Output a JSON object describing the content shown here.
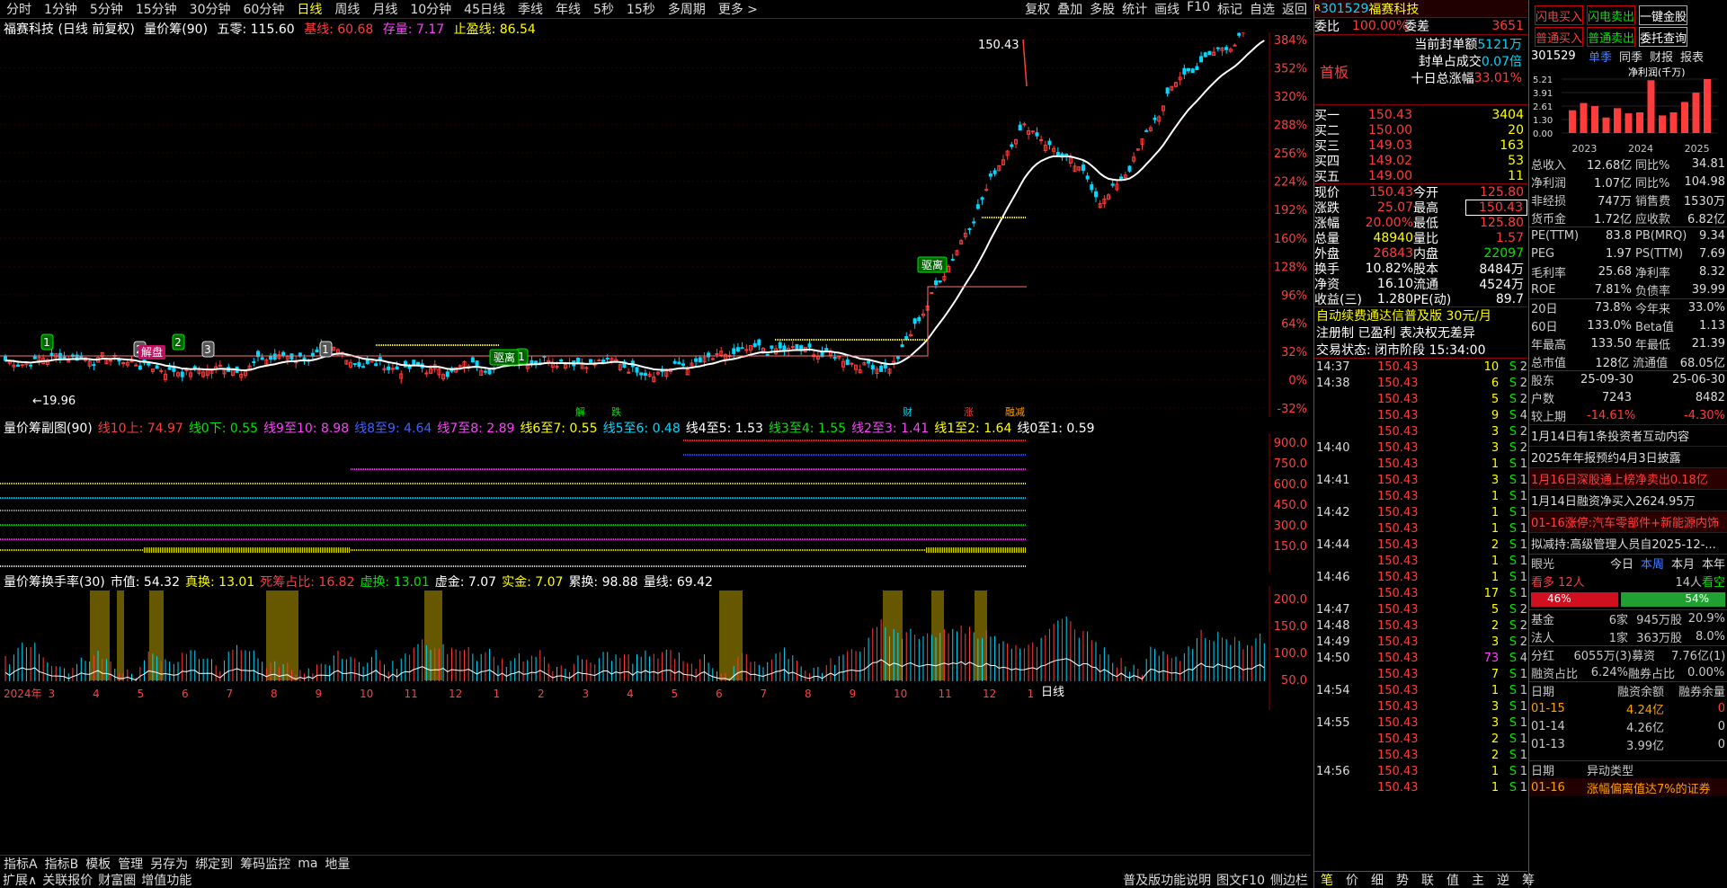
{
  "toolbar": {
    "periods": [
      "分时",
      "1分钟",
      "5分钟",
      "15分钟",
      "30分钟",
      "60分钟",
      "日线",
      "周线",
      "月线",
      "10分钟",
      "45日线",
      "季线",
      "年线",
      "5秒",
      "15秒",
      "多周期",
      "更多 >"
    ],
    "active": "日线",
    "right": [
      "复权",
      "叠加",
      "多股",
      "统计",
      "画线",
      "F10",
      "标记",
      "自选",
      "返回"
    ]
  },
  "info": {
    "name": "福赛科技 (日线 前复权)",
    "ind": "量价筹(90)",
    "wuling": "五零: 115.60",
    "jixian": "基线: 60.68",
    "cunliang": "存量: 7.17",
    "zhiying": "止盈线: 86.54"
  },
  "main_axis": [
    "384%",
    "352%",
    "320%",
    "288%",
    "256%",
    "224%",
    "192%",
    "160%",
    "128%",
    "96%",
    "64%",
    "32%",
    "0%",
    "-32%"
  ],
  "labels": {
    "high": "150.43",
    "low": "19.96",
    "badges": [
      "1",
      "2",
      "2",
      "3",
      "1",
      "1"
    ],
    "qumai": "驱离",
    "qumai2": "驱离",
    "jiepan": "解盘",
    "days": [
      "解",
      "跌",
      "涨",
      "融减",
      "财"
    ]
  },
  "sub": {
    "title": "量价筹副图(90)",
    "items": [
      {
        "k": "线10上:",
        "v": "74.97",
        "c": "r"
      },
      {
        "k": "线0下:",
        "v": "0.55",
        "c": "g"
      },
      {
        "k": "线9至10:",
        "v": "8.98",
        "c": "m"
      },
      {
        "k": "线8至9:",
        "v": "4.64",
        "c": "b"
      },
      {
        "k": "线7至8:",
        "v": "2.89",
        "c": "m"
      },
      {
        "k": "线6至7:",
        "v": "0.55",
        "c": "y"
      },
      {
        "k": "线5至6:",
        "v": "0.48",
        "c": "c"
      },
      {
        "k": "线4至5:",
        "v": "1.53",
        "c": "w"
      },
      {
        "k": "线3至4:",
        "v": "1.55",
        "c": "g"
      },
      {
        "k": "线2至3:",
        "v": "1.41",
        "c": "m"
      },
      {
        "k": "线1至2:",
        "v": "1.64",
        "c": "y"
      },
      {
        "k": "线0至1:",
        "v": "0.59",
        "c": "w"
      }
    ],
    "axis": [
      "900.0",
      "750.0",
      "600.0",
      "450.0",
      "300.0",
      "150.0"
    ]
  },
  "tv": {
    "title": "量价筹换手率(30)",
    "items": [
      {
        "k": "市值:",
        "v": "54.32",
        "c": "w"
      },
      {
        "k": "真换:",
        "v": "13.01",
        "c": "y"
      },
      {
        "k": "死筹占比:",
        "v": "16.82",
        "c": "r"
      },
      {
        "k": "虚换:",
        "v": "13.01",
        "c": "g"
      },
      {
        "k": "虚金:",
        "v": "7.07",
        "c": "w"
      },
      {
        "k": "实金:",
        "v": "7.07",
        "c": "y"
      },
      {
        "k": "累换:",
        "v": "98.88",
        "c": "w"
      },
      {
        "k": "量线:",
        "v": "69.42",
        "c": "w"
      }
    ],
    "axis": [
      "200.0",
      "150.0",
      "100.0",
      "50.0"
    ],
    "months": [
      "2024年",
      "3",
      "4",
      "5",
      "6",
      "7",
      "8",
      "9",
      "10",
      "11",
      "12",
      "1",
      "2",
      "3",
      "4",
      "5",
      "6",
      "7",
      "8",
      "9",
      "10",
      "11",
      "12",
      "1"
    ],
    "daycycle": "日线"
  },
  "bottom1": [
    "指标A",
    "指标B",
    "模板",
    "管理",
    "另存为",
    "绑定到",
    "筹码监控",
    "ma",
    "地量"
  ],
  "bottom2": [
    "扩展∧",
    "关联报价",
    "财富圈",
    "增值功能"
  ],
  "bottom_right": [
    "普及版功能说明",
    "图文F10",
    "侧边栏"
  ],
  "fbottom": [
    "笔",
    "价",
    "细",
    "势",
    "联",
    "值",
    "主",
    "逆",
    "筹"
  ],
  "quote": {
    "code": "301529",
    "name": "福赛科技",
    "weibi": "委比",
    "weibi_v": "100.00%",
    "weicha": "委差",
    "weicha_v": "3651",
    "board": "首板",
    "lines": [
      {
        "k": "当前封单额",
        "v": "5121万"
      },
      {
        "k": "封单占成交",
        "v": "0.07倍"
      },
      {
        "k": "十日总涨幅",
        "v": "33.01%"
      }
    ],
    "buys": [
      {
        "k": "买一",
        "p": "150.43",
        "v": "3404"
      },
      {
        "k": "买二",
        "p": "150.00",
        "v": "20"
      },
      {
        "k": "买三",
        "p": "149.03",
        "v": "163"
      },
      {
        "k": "买四",
        "p": "149.02",
        "v": "53"
      },
      {
        "k": "买五",
        "p": "149.00",
        "v": "11"
      }
    ],
    "stats": [
      [
        "现价",
        "150.43",
        "今开",
        "125.80"
      ],
      [
        "涨跌",
        "25.07",
        "最高",
        "150.43"
      ],
      [
        "涨幅",
        "20.00%",
        "最低",
        "125.80"
      ],
      [
        "总量",
        "48940",
        "量比",
        "1.57"
      ],
      [
        "外盘",
        "26843",
        "内盘",
        "22097"
      ],
      [
        "换手",
        "10.82%",
        "股本",
        "8484万"
      ],
      [
        "净资",
        "16.10",
        "流通",
        "4524万"
      ],
      [
        "收益(三)",
        "1.280",
        "PE(动)",
        "89.7"
      ]
    ],
    "promo": "自动续费通达信普及版 30元/月",
    "reg": "注册制 已盈利 表决权无差异",
    "status": "交易状态: 闭市阶段 15:34:00",
    "ticks": [
      [
        "14:37",
        "150.43",
        "10",
        "S",
        "2"
      ],
      [
        "14:38",
        "150.43",
        "6",
        "S",
        "2"
      ],
      [
        "",
        "150.43",
        "5",
        "S",
        "2"
      ],
      [
        "",
        "150.43",
        "9",
        "S",
        "4"
      ],
      [
        "",
        "150.43",
        "3",
        "S",
        "2"
      ],
      [
        "14:40",
        "150.43",
        "3",
        "S",
        "2"
      ],
      [
        "",
        "150.43",
        "1",
        "S",
        "1"
      ],
      [
        "14:41",
        "150.43",
        "3",
        "S",
        "1"
      ],
      [
        "",
        "150.43",
        "1",
        "S",
        "1"
      ],
      [
        "14:42",
        "150.43",
        "1",
        "S",
        "1"
      ],
      [
        "",
        "150.43",
        "1",
        "S",
        "1"
      ],
      [
        "14:44",
        "150.43",
        "2",
        "S",
        "1"
      ],
      [
        "",
        "150.43",
        "1",
        "S",
        "1"
      ],
      [
        "14:46",
        "150.43",
        "1",
        "S",
        "1"
      ],
      [
        "",
        "150.43",
        "17",
        "S",
        "1"
      ],
      [
        "14:47",
        "150.43",
        "5",
        "S",
        "2"
      ],
      [
        "14:48",
        "150.43",
        "2",
        "S",
        "2"
      ],
      [
        "14:49",
        "150.43",
        "3",
        "S",
        "2"
      ],
      [
        "14:50",
        "150.43",
        "73",
        "S",
        "4"
      ],
      [
        "",
        "150.43",
        "7",
        "S",
        "1"
      ],
      [
        "14:54",
        "150.43",
        "1",
        "S",
        "1"
      ],
      [
        "",
        "150.43",
        "3",
        "S",
        "1"
      ],
      [
        "14:55",
        "150.43",
        "3",
        "S",
        "1"
      ],
      [
        "",
        "150.43",
        "2",
        "S",
        "1"
      ],
      [
        "",
        "150.43",
        "2",
        "S",
        "1"
      ],
      [
        "14:56",
        "150.43",
        "1",
        "S",
        "1"
      ],
      [
        "",
        "150.43",
        "1",
        "S",
        "1"
      ]
    ]
  },
  "fin": {
    "btns": [
      "闪电买入",
      "闪电卖出",
      "一键金股",
      "普通买入",
      "普通卖出",
      "委托查询"
    ],
    "code": "301529",
    "tabs": [
      "单季",
      "同季",
      "财报",
      "报表"
    ],
    "chart_title": "净利润(千万)",
    "yaxis": [
      "5.21",
      "3.91",
      "2.61",
      "1.30",
      "0.00"
    ],
    "xaxis": [
      "2023",
      "2024",
      "2025"
    ],
    "bars": [
      2.2,
      2.9,
      2.6,
      1.5,
      2.4,
      1.9,
      2.0,
      5.1,
      1.7,
      2.0,
      3.0,
      3.9,
      5.21
    ],
    "rows": [
      [
        "总收入",
        "12.68亿",
        "同比%",
        "34.81"
      ],
      [
        "净利润",
        "1.07亿",
        "同比%",
        "104.98"
      ],
      [
        "非经损",
        "747万",
        "销售费",
        "1530万"
      ],
      [
        "货币金",
        "1.72亿",
        "应收款",
        "6.82亿"
      ],
      [
        "PE(TTM)",
        "83.8",
        "PB(MRQ)",
        "9.34"
      ],
      [
        "PEG",
        "1.97",
        "PS(TTM)",
        "7.69"
      ],
      [
        "毛利率",
        "25.68",
        "净利率",
        "8.32"
      ],
      [
        "ROE",
        "7.81%",
        "负债率",
        "39.99"
      ],
      [
        "20日",
        "73.8%",
        "今年来",
        "33.0%"
      ],
      [
        "60日",
        "133.0%",
        "Beta值",
        "1.13"
      ],
      [
        "年最高",
        "133.50",
        "年最低",
        "21.39"
      ],
      [
        "总市值",
        "128亿",
        "流通值",
        "68.05亿"
      ],
      [
        "股东",
        "25-09-30",
        "",
        "25-06-30"
      ],
      [
        "户数",
        "7243",
        "",
        "8482"
      ],
      [
        "较上期",
        "-14.61%",
        "",
        "-4.30%"
      ]
    ],
    "news": [
      "1月14日有1条投资者互动内容",
      "2025年年报预约4月3日披露",
      "1月16日深股通上榜净卖出0.18亿",
      "1月14日融资净买入2624.95万",
      "01-16涨停:汽车零部件+新能源内饰",
      "拟减持:高级管理人员自2025-12-..."
    ],
    "eye": "眼光",
    "eyetabs": [
      "今日",
      "本周",
      "本月",
      "本年"
    ],
    "bull": "看多",
    "bull_n": "12人",
    "bear": "看空",
    "bear_n": "14人",
    "bull_pct": "46%",
    "bear_pct": "54%",
    "bull_frac": 0.46,
    "holders": [
      [
        "基金",
        "6家",
        "945万股",
        "20.9%"
      ],
      [
        "法人",
        "1家",
        "363万股",
        "8.0%"
      ]
    ],
    "div": [
      "分红",
      "6055万(3)",
      "募资",
      "7.76亿(1)"
    ],
    "margin_ratio": [
      "融资占比",
      "6.24%",
      "融券占比",
      "0.00%"
    ],
    "margin_head": [
      "日期",
      "融资余额",
      "融券余量"
    ],
    "margin": [
      [
        "01-15",
        "4.24亿",
        "0"
      ],
      [
        "01-14",
        "4.26亿",
        "0"
      ],
      [
        "01-13",
        "3.99亿",
        "0"
      ]
    ],
    "abn_head": [
      "日期",
      "异动类型"
    ],
    "abn": [
      "01-16",
      "涨幅偏离值达7%的证券"
    ]
  }
}
